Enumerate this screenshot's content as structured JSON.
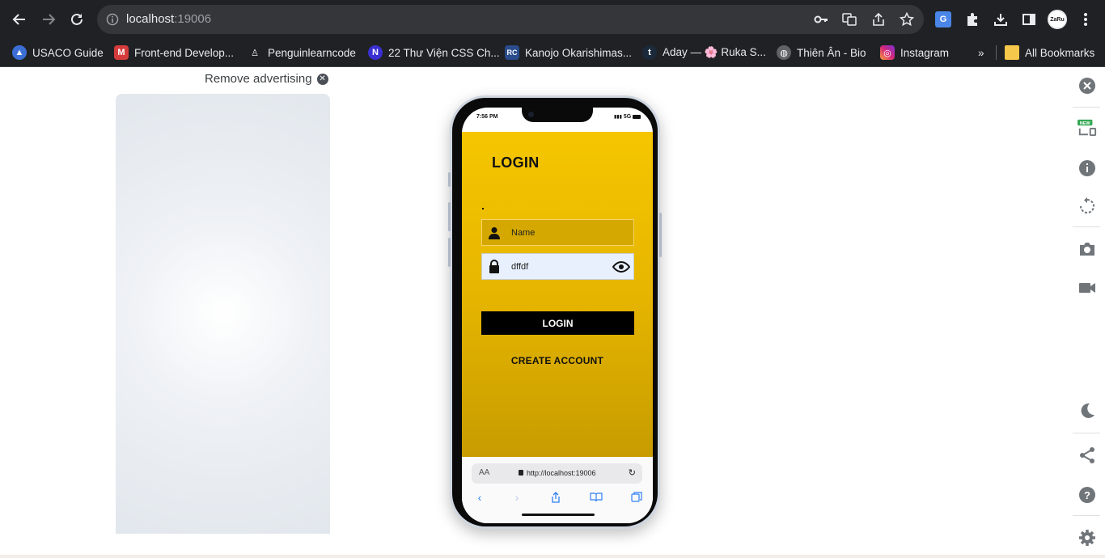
{
  "browser": {
    "url_host": "localhost",
    "url_port": ":19006",
    "bookmarks": [
      {
        "label": "USACO Guide",
        "icon": "usaco-icon",
        "color": "#3b6fd6"
      },
      {
        "label": "Front-end Develop...",
        "icon": "frontend-icon",
        "color": "#d63b3b"
      },
      {
        "label": "Penguinlearncode",
        "icon": "penguin-icon",
        "color": "#444444"
      },
      {
        "label": "22 Thư Viện CSS Ch...",
        "icon": "n-icon",
        "color": "#3a2fd1"
      },
      {
        "label": "Kanojo Okarishimas...",
        "icon": "rc-icon",
        "color": "#2a4b8c"
      },
      {
        "label": "Aday — 🌸 Ruka S...",
        "icon": "tumblr-icon",
        "color": "#1b2a3a"
      },
      {
        "label": "Thiên Ân - Bio",
        "icon": "globe-icon",
        "color": "#5f6368"
      },
      {
        "label": "Instagram",
        "icon": "instagram-icon",
        "color": "#d6287a"
      }
    ],
    "more": "»",
    "all_bookmarks": "All Bookmarks"
  },
  "page": {
    "remove_ad": "Remove advertising"
  },
  "phone": {
    "time": "7:56 PM",
    "signal": "5G",
    "app_title": "LOGIN",
    "name_placeholder": "Name",
    "password_value": "dffdf",
    "login_button": "LOGIN",
    "create_account": "CREATE ACCOUNT",
    "safari_aa": "AA",
    "safari_url": "http://localhost:19006"
  },
  "colors": {
    "app_yellow": "#f5c600",
    "app_dark_yellow": "#c79c00",
    "chrome_bg": "#202124"
  }
}
